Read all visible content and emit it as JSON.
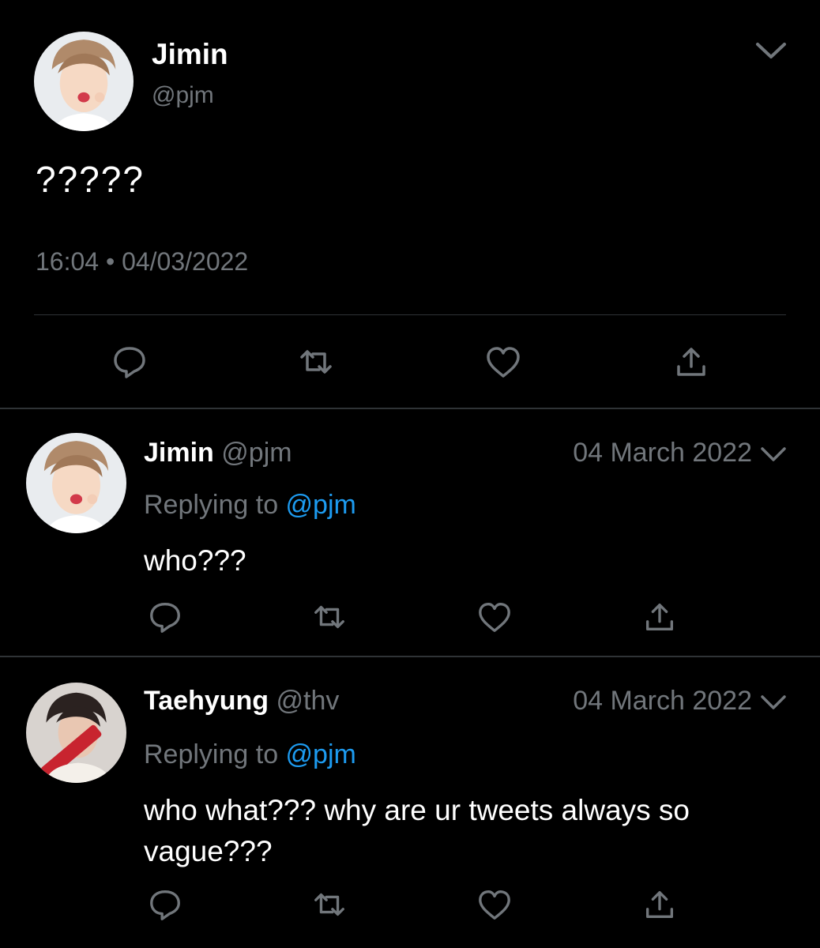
{
  "main_tweet": {
    "name": "Jimin",
    "handle": "@pjm",
    "text": "?????",
    "timestamp": "16:04 • 04/03/2022",
    "avatar_icon": "profile-photo-jimin"
  },
  "replies": [
    {
      "name": "Jimin",
      "handle": "@pjm",
      "date": "04 March 2022",
      "replying_prefix": "Replying to ",
      "replying_to": "@pjm",
      "text": "who???",
      "avatar_icon": "profile-photo-jimin"
    },
    {
      "name": "Taehyung",
      "handle": "@thv",
      "date": "04 March 2022",
      "replying_prefix": "Replying to ",
      "replying_to": "@pjm",
      "text": "who what??? why are ur tweets always so vague???",
      "avatar_icon": "profile-photo-taehyung"
    }
  ],
  "action_icons": [
    "reply-icon",
    "retweet-icon",
    "like-icon",
    "share-icon"
  ],
  "colors": {
    "background": "#000000",
    "primary_text": "#ffffff",
    "secondary_text": "#71767b",
    "link": "#1d9bf0",
    "divider": "#2f3336"
  }
}
